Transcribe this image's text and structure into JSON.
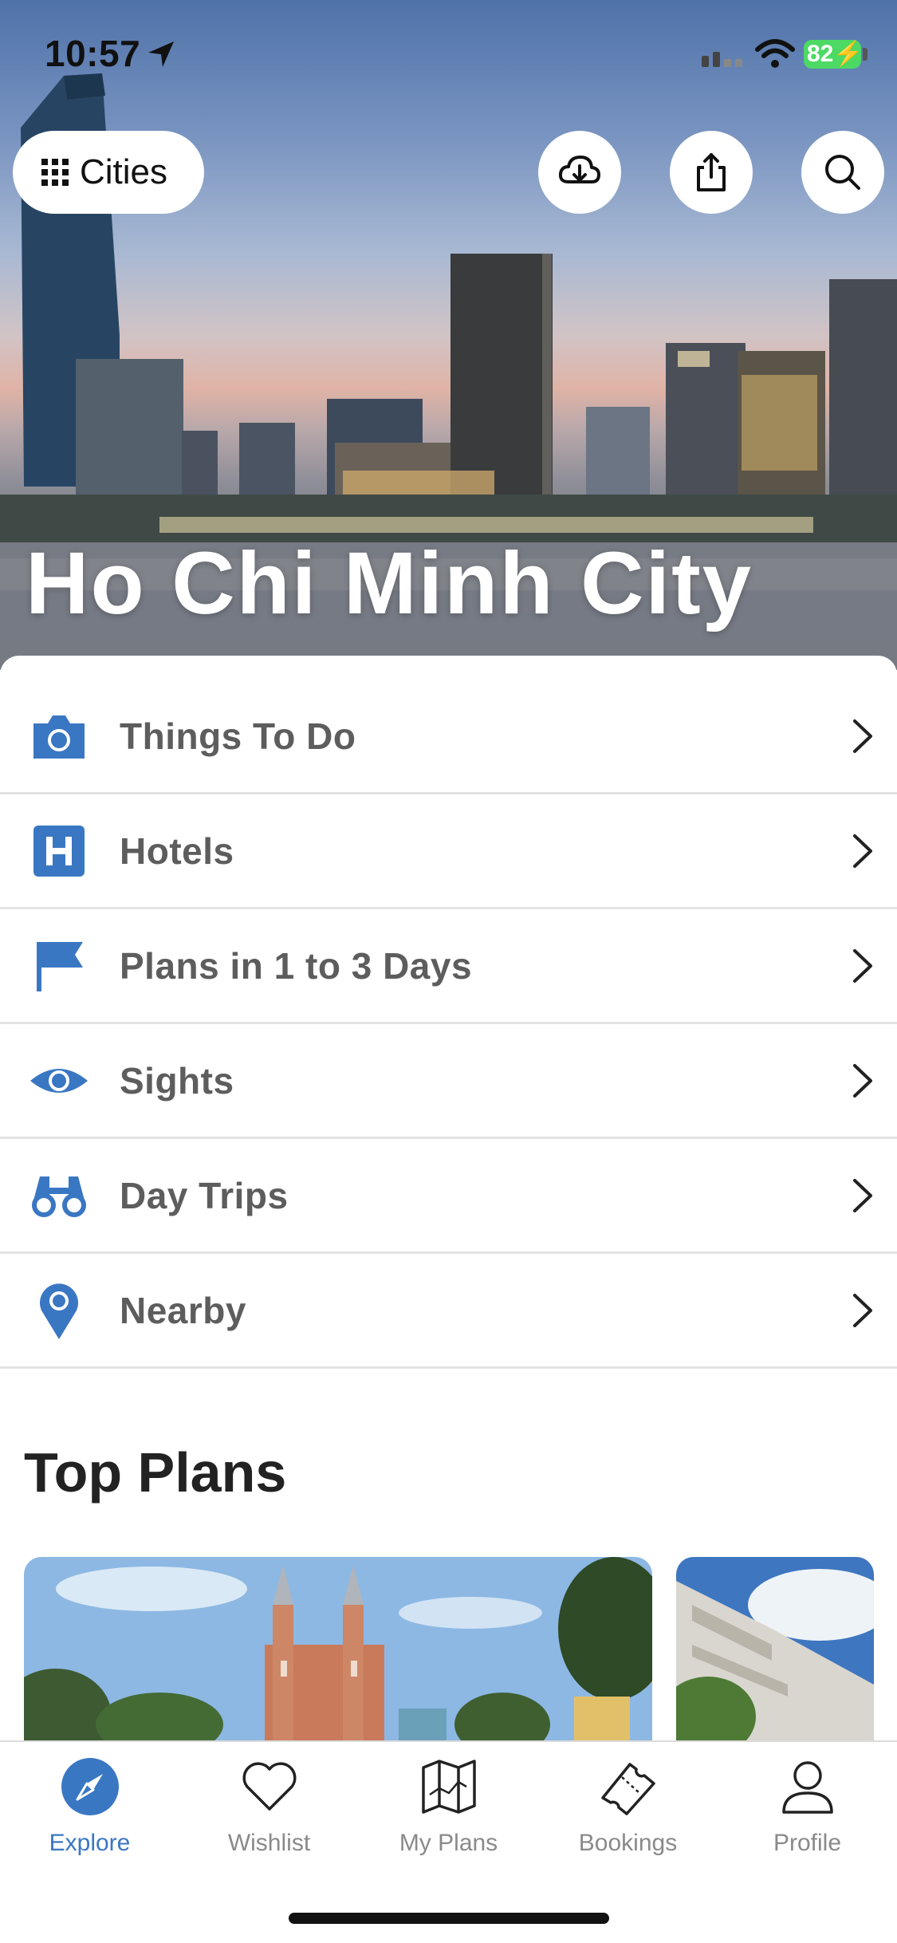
{
  "status_bar": {
    "time": "10:57",
    "battery": "82"
  },
  "header": {
    "cities_label": "Cities",
    "icons": [
      "grid-icon",
      "cloud-download-icon",
      "share-icon",
      "search-icon"
    ]
  },
  "city": {
    "title": "Ho Chi Minh City"
  },
  "menu": [
    {
      "label": "Things To Do",
      "icon": "camera-icon"
    },
    {
      "label": "Hotels",
      "icon": "hotel-icon"
    },
    {
      "label": "Plans in 1 to 3 Days",
      "icon": "flag-icon"
    },
    {
      "label": "Sights",
      "icon": "eye-icon"
    },
    {
      "label": "Day Trips",
      "icon": "binoculars-icon"
    },
    {
      "label": "Nearby",
      "icon": "map-pin-icon"
    }
  ],
  "top_plans": {
    "title": "Top Plans"
  },
  "tabs": [
    {
      "label": "Explore",
      "icon": "compass-icon",
      "active": true
    },
    {
      "label": "Wishlist",
      "icon": "heart-icon",
      "active": false
    },
    {
      "label": "My Plans",
      "icon": "map-icon",
      "active": false
    },
    {
      "label": "Bookings",
      "icon": "ticket-icon",
      "active": false
    },
    {
      "label": "Profile",
      "icon": "user-icon",
      "active": false
    }
  ],
  "colors": {
    "accent": "#3a77c3",
    "text_muted": "#5d5d5d",
    "tab_inactive": "#8a8a8a"
  }
}
